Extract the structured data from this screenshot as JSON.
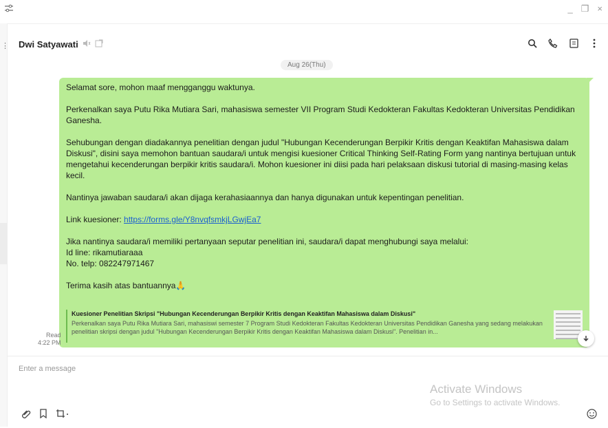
{
  "window": {
    "minimize": "_",
    "restore": "❐",
    "close": "×"
  },
  "header": {
    "contact_name": "Dwi Satyawati"
  },
  "date_chip": "Aug 26(Thu)",
  "message": {
    "line1": "Selamat sore, mohon maaf mengganggu waktunya.",
    "line2": "Perkenalkan saya Putu Rika Mutiara Sari, mahasiswa semester VII Program Studi Kedokteran Fakultas Kedokteran Universitas Pendidikan Ganesha.",
    "line3": "Sehubungan dengan diadakannya penelitian dengan judul \"Hubungan Kecenderungan Berpikir Kritis dengan Keaktifan Mahasiswa dalam Diskusi\", disini saya memohon bantuan saudara/i untuk mengisi kuesioner Critical Thinking Self-Rating Form yang nantinya bertujuan untuk mengetahui kecenderungan berpikir kritis saudara/i. Mohon kuesioner ini diisi pada hari pelaksaan diskusi tutorial di masing-masing kelas kecil.",
    "line4": "Nantinya jawaban saudara/i akan dijaga kerahasiaannya dan hanya digunakan untuk kepentingan penelitian.",
    "link_label": "Link kuesioner: ",
    "link_url": "https://forms.gle/Y8nvqfsmkjLGwjEa7",
    "contact_line": "Jika nantinya saudara/i memiliki pertanyaan seputar penelitian ini, saudara/i dapat menghubungi saya melalui:",
    "id_line": "Id line: rikamutiaraaa",
    "phone": "No. telp: 082247971467",
    "thanks": "Terima kasih atas bantuannya🙏"
  },
  "link_preview": {
    "title": "Kuesioner Penelitian Skripsi \"Hubungan Kecenderungan Berpikir Kritis dengan Keaktifan Mahasiswa dalam Diskusi\"",
    "description": "Perkenalkan saya Putu Rika Mutiara Sari, mahasiswi semester 7 Program Studi Kedokteran Fakultas Kedokteran Universitas Pendidikan Ganesha yang sedang melakukan penelitian skripsi dengan judul \"Hubungan Kecenderungan Berpikir Kritis dengan Keaktifan Mahasiswa dalam Diskusi\". Penelitian in..."
  },
  "meta": {
    "read": "Read",
    "time": "4:22 PM"
  },
  "compose": {
    "placeholder": "Enter a message"
  },
  "watermark": {
    "title": "Activate Windows",
    "subtitle": "Go to Settings to activate Windows."
  },
  "icons": {
    "search": "search-icon",
    "call": "phone-icon",
    "notes": "notes-icon",
    "more": "more-vertical-icon",
    "mute": "mute-icon",
    "attach": "paperclip-icon",
    "bookmark": "bookmark-icon",
    "crop": "screenshot-icon",
    "emoji": "emoji-icon",
    "scroll_down": "arrow-down-icon"
  },
  "colors": {
    "bubble": "#b9ec95",
    "link": "#1a5fd0"
  }
}
